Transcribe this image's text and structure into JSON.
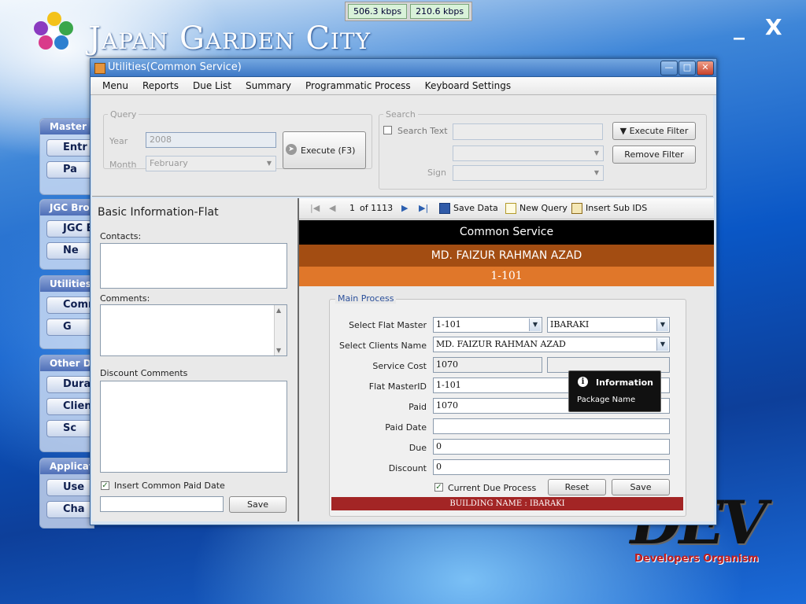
{
  "network": {
    "download": "506.3 kbps",
    "upload": "210.6 kbps"
  },
  "app": {
    "title": "Japan Garden City",
    "minimize": "_",
    "close": "X"
  },
  "side_groups": [
    {
      "head": "Master D",
      "buttons": [
        "Entr",
        "Pa"
      ]
    },
    {
      "head": "JGC Broa",
      "buttons": [
        "JGC B",
        "Ne"
      ]
    },
    {
      "head": "Utilities",
      "buttons": [
        "Comm",
        "G"
      ]
    },
    {
      "head": "Other De",
      "buttons": [
        "Duratio",
        "Client",
        "Sc"
      ]
    },
    {
      "head": "Applicat",
      "buttons": [
        "Use",
        "Cha"
      ]
    }
  ],
  "brand": {
    "logo_text": "DEV",
    "tagline": "Developers Organism"
  },
  "window": {
    "title": "Utilities(Common Service)",
    "menu": [
      "Menu",
      "Reports",
      "Due List",
      "Summary",
      "Programmatic Process",
      "Keyboard Settings"
    ]
  },
  "query": {
    "legend": "Query",
    "year_label": "Year",
    "year_value": "2008",
    "month_label": "Month",
    "month_value": "February",
    "execute_label": "Execute (F3)"
  },
  "search": {
    "legend": "Search",
    "search_text_label": "Search Text",
    "sign_label": "Sign",
    "execute_filter_label": "Execute Filter",
    "remove_filter_label": "Remove Filter"
  },
  "left_pane": {
    "heading": "Basic Information-Flat",
    "contacts_label": "Contacts:",
    "comments_label": "Comments:",
    "discount_label": "Discount Comments",
    "insert_paid_label": "Insert Common Paid Date",
    "insert_paid_checked": true,
    "save_label": "Save"
  },
  "toolbar": {
    "page_current": "1",
    "page_total": "of 1113",
    "save_data": "Save Data",
    "new_query": "New Query",
    "insert_sub": "Insert Sub IDS"
  },
  "header": {
    "service": "Common Service",
    "client": "MD. FAIZUR RAHMAN AZAD",
    "flat": "1-101"
  },
  "main_process": {
    "legend": "Main Process",
    "flat_master_label": "Select Flat Master",
    "flat_master_value": "1-101",
    "building_value": "IBARAKI",
    "client_label": "Select Clients Name",
    "client_value": "MD. FAIZUR RAHMAN AZAD",
    "service_cost_label": "Service Cost",
    "service_cost_value": "1070",
    "flat_master_id_label": "Flat MasterID",
    "flat_master_id_value": "1-101",
    "paid_label": "Paid",
    "paid_value": "1070",
    "paid_date_label": "Paid Date",
    "paid_date_value": "",
    "due_label": "Due",
    "due_value": "0",
    "discount_label": "Discount",
    "discount_value": "0",
    "current_due_label": "Current Due Process",
    "current_due_checked": true,
    "reset_label": "Reset",
    "save_label": "Save",
    "building_banner": "BUILDING NAME : IBARAKI"
  },
  "tooltip": {
    "title": "Information",
    "body": "Package Name"
  }
}
